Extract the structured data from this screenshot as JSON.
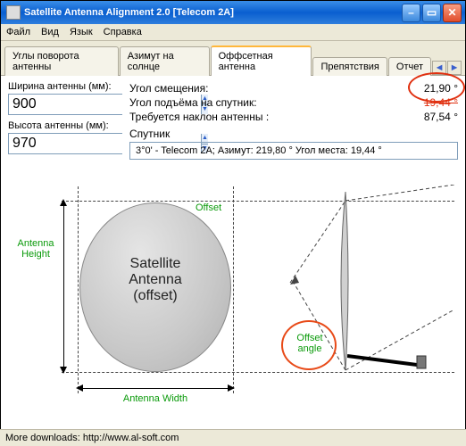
{
  "window": {
    "title": "Satellite Antenna Alignment 2.0 [Telecom 2A]"
  },
  "menu": {
    "file": "Файл",
    "view": "Вид",
    "lang": "Язык",
    "help": "Справка"
  },
  "tabs": {
    "t0": "Углы поворота антенны",
    "t1": "Азимут на солнце",
    "t2": "Оффсетная антенна",
    "t3": "Препятствия",
    "t4": "Отчет"
  },
  "inputs": {
    "width_label": "Ширина антенны (мм):",
    "width_value": "900",
    "height_label": "Высота антенны (мм):",
    "height_value": "970"
  },
  "angles": {
    "offset_label": "Угол смещения:",
    "offset_value": "21,90 °",
    "elev_label": "Угол подъёма на спутник:",
    "elev_value": "19,44 °",
    "tilt_label": "Требуется наклон антенны :",
    "tilt_value": "87,54 °"
  },
  "sat": {
    "label": "Спутник",
    "value": "3°0' - Telecom 2A;  Азимут: 219,80 °  Угол места: 19,44 °"
  },
  "diagram": {
    "antenna_height": "Antenna Height",
    "antenna_width": "Antenna Width",
    "offset": "Offset",
    "center_l1": "Satellite",
    "center_l2": "Antenna",
    "center_l3": "(offset)",
    "offset_angle_l1": "Offset",
    "offset_angle_l2": "angle"
  },
  "status": {
    "text": "More downloads: http://www.al-soft.com"
  }
}
